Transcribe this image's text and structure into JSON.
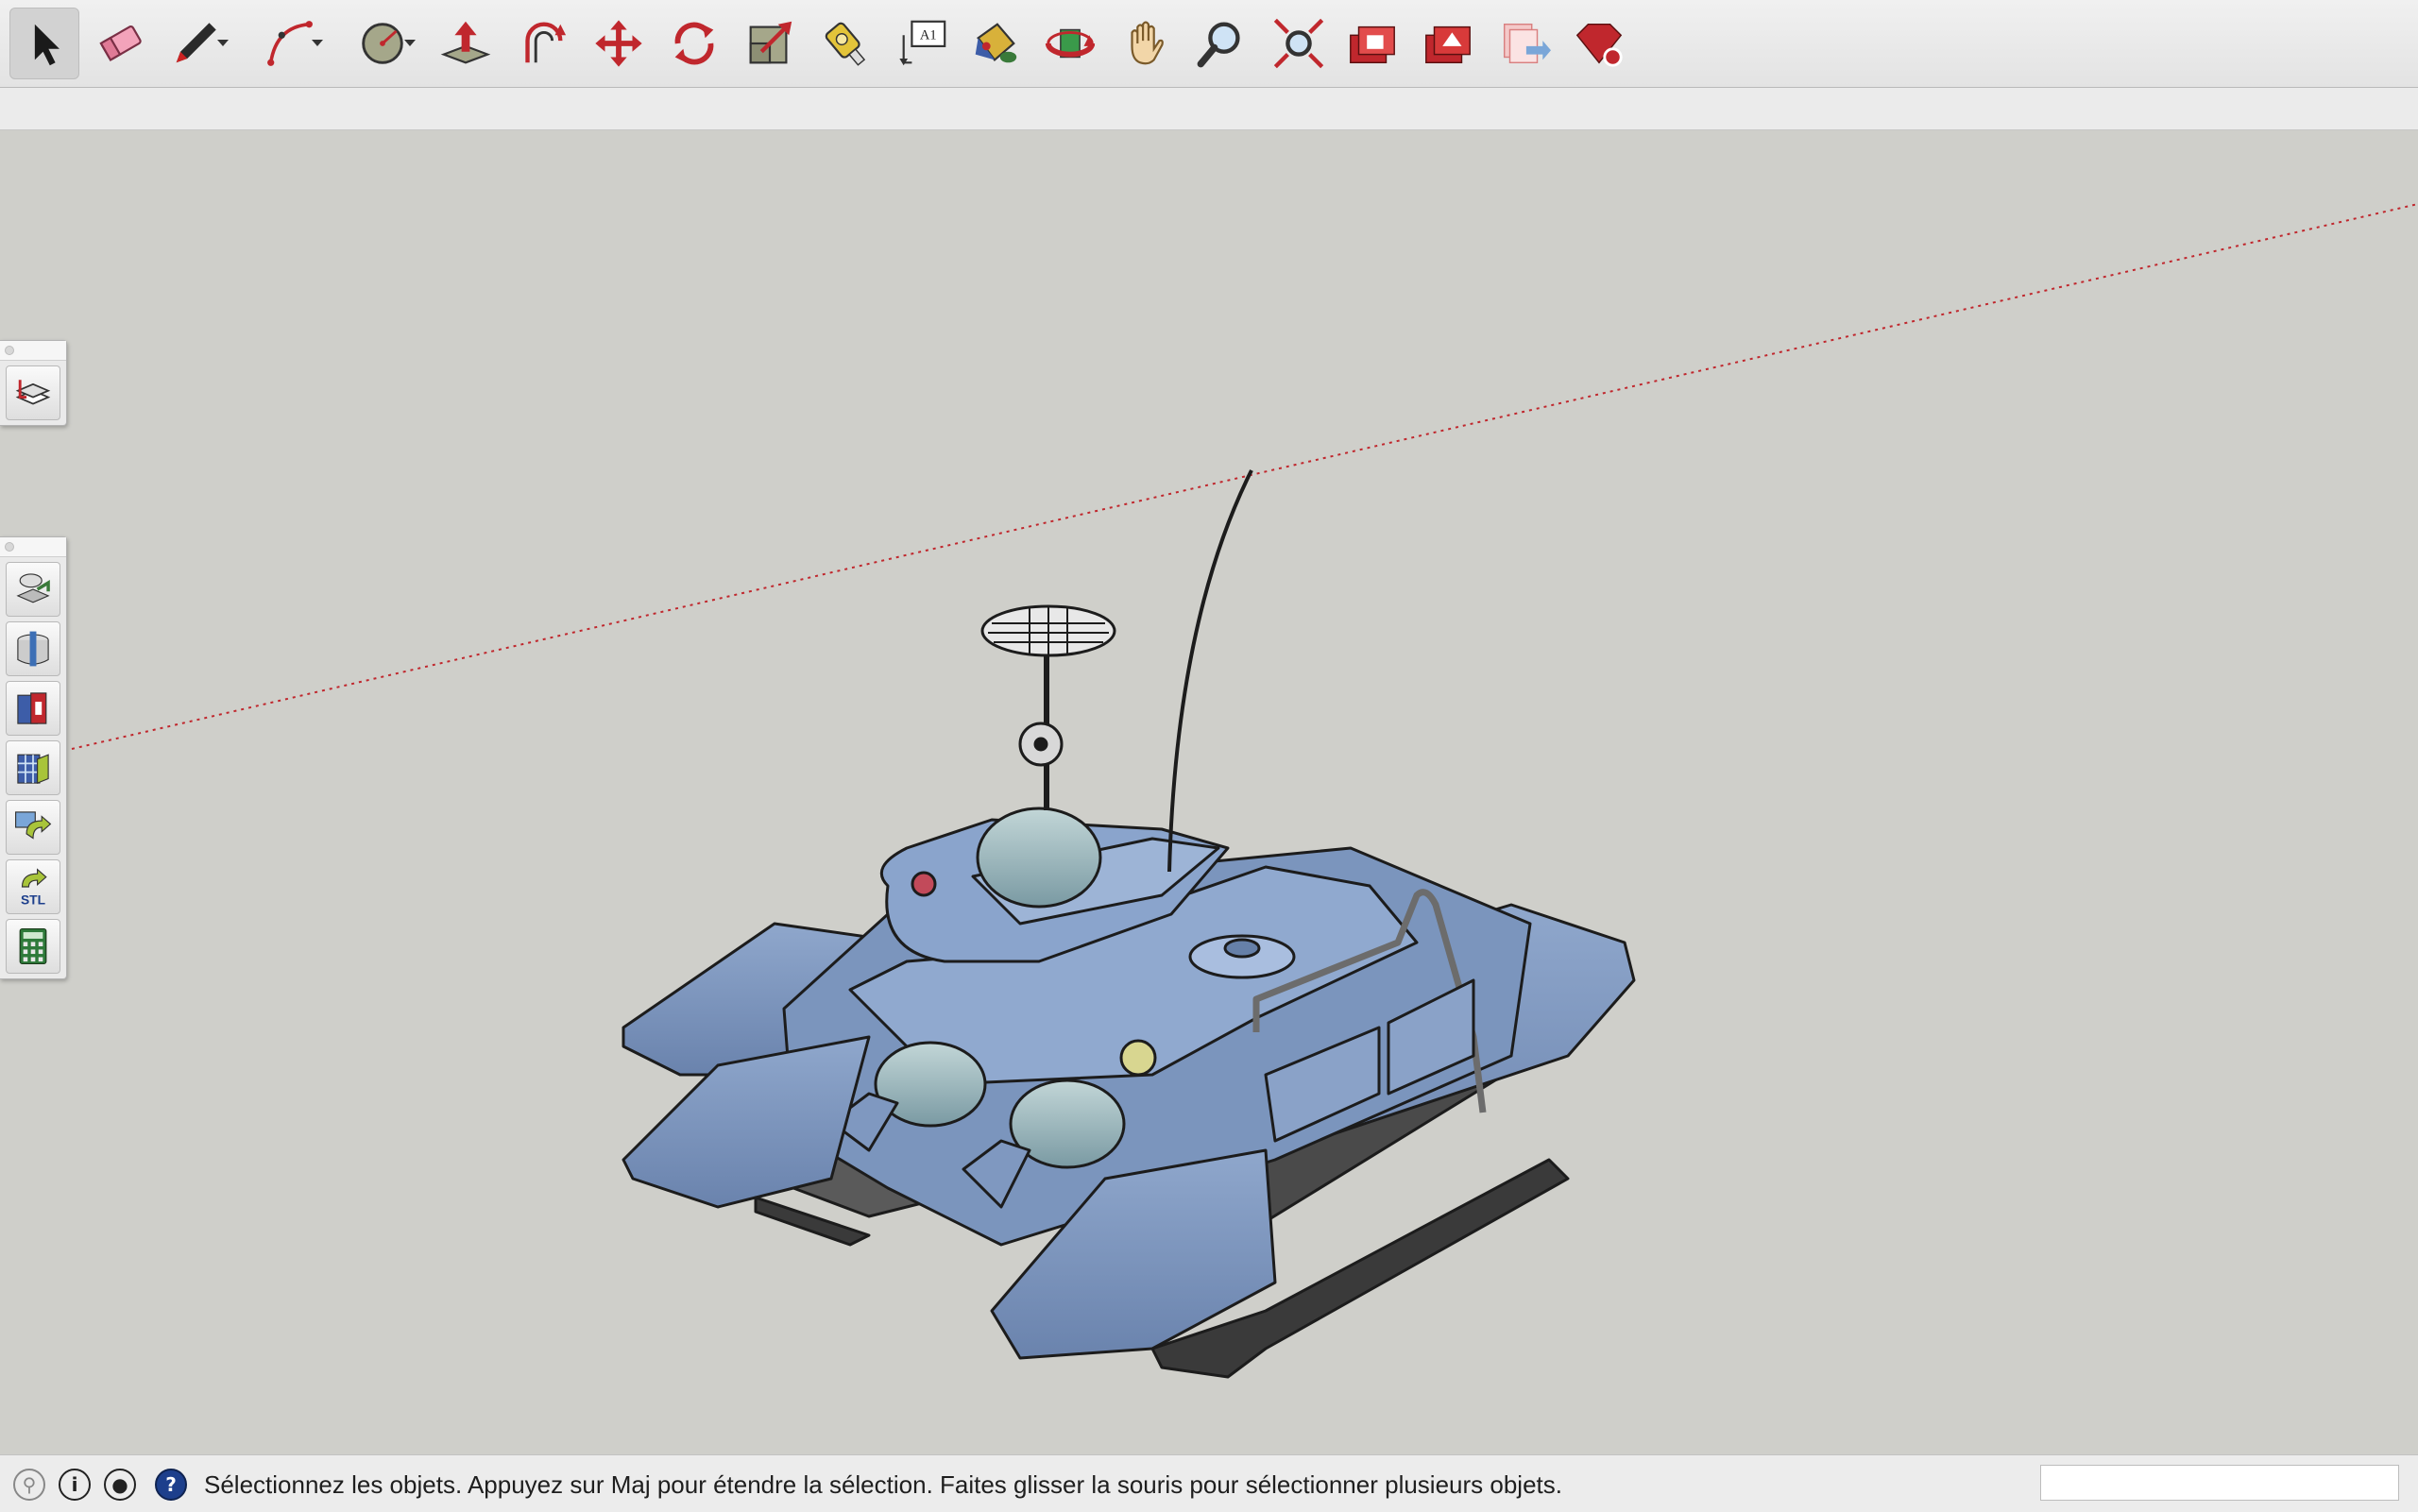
{
  "toolbar": {
    "tools": [
      {
        "id": "select",
        "icon": "select-arrow-icon",
        "active": true
      },
      {
        "id": "eraser",
        "icon": "eraser-icon"
      },
      {
        "id": "pencil",
        "icon": "pencil-icon",
        "dropdown": true
      },
      {
        "id": "arc",
        "icon": "arc-icon",
        "dropdown": true
      },
      {
        "id": "circle",
        "icon": "circle-icon",
        "dropdown": true
      },
      {
        "id": "pushpull",
        "icon": "push-pull-icon"
      },
      {
        "id": "offset",
        "icon": "offset-icon"
      },
      {
        "id": "move",
        "icon": "move-icon"
      },
      {
        "id": "rotate",
        "icon": "rotate-icon"
      },
      {
        "id": "scale",
        "icon": "scale-icon"
      },
      {
        "id": "tape",
        "icon": "tape-measure-icon"
      },
      {
        "id": "text",
        "icon": "text-label-icon",
        "label": "A1"
      },
      {
        "id": "paint",
        "icon": "paint-bucket-icon"
      },
      {
        "id": "orbit",
        "icon": "orbit-icon"
      },
      {
        "id": "pan",
        "icon": "pan-hand-icon"
      },
      {
        "id": "zoom",
        "icon": "zoom-icon"
      },
      {
        "id": "zoom-extents",
        "icon": "zoom-extents-icon"
      },
      {
        "id": "warehouse",
        "icon": "3d-warehouse-icon"
      },
      {
        "id": "extension-warehouse",
        "icon": "extension-warehouse-icon"
      },
      {
        "id": "send-to-layout",
        "icon": "send-to-layout-icon"
      },
      {
        "id": "extension-manager",
        "icon": "extension-manager-icon"
      }
    ]
  },
  "panels": {
    "layers": {
      "tools": [
        {
          "icon": "layers-icon"
        }
      ]
    },
    "extensions": {
      "tools": [
        {
          "icon": "solid-inspector-icon"
        },
        {
          "icon": "section-plane-icon"
        },
        {
          "icon": "sandbox-icon"
        },
        {
          "icon": "component-grid-icon"
        },
        {
          "icon": "import-icon"
        },
        {
          "icon": "stl-export-icon",
          "label": "STL"
        },
        {
          "icon": "calculator-icon"
        }
      ]
    }
  },
  "statusbar": {
    "icons": [
      "geo-location-icon",
      "credits-icon",
      "account-icon",
      "help-icon"
    ],
    "message": "Sélectionnez les objets. Appuyez sur Maj pour étendre la sélection. Faites glisser la souris pour sélectionner plusieurs objets.",
    "measurements_value": ""
  },
  "colors": {
    "canvas": "#cfcfca",
    "model": "#7b95bd",
    "axis_red": "#c0272d",
    "help_blue": "#1d3f8c"
  }
}
